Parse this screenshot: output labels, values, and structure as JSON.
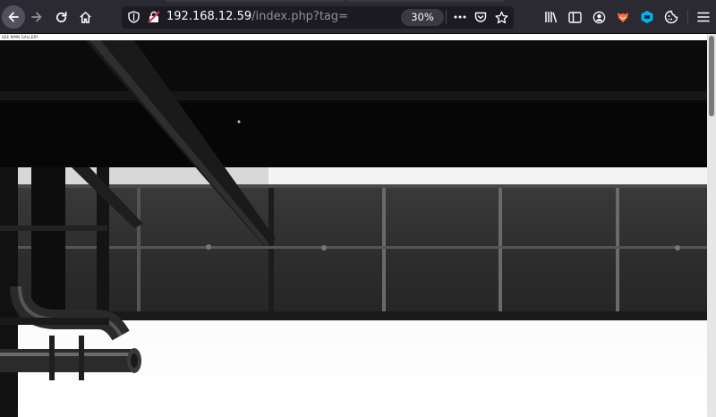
{
  "browser": {
    "url_host": "192.168.12.59",
    "url_path": "/index.php?tag=",
    "zoom_label": "30%",
    "toolbar_icons": [
      "back-icon",
      "forward-icon",
      "reload-icon",
      "home-icon",
      "shield-icon",
      "insecure-lock-icon",
      "page-actions-icon",
      "pocket-icon",
      "bookmark-star-icon",
      "library-icon",
      "sidebar-icon",
      "account-icon",
      "extension-fox-icon",
      "extension-cube-icon",
      "cookie-icon",
      "menu-icon"
    ]
  },
  "page": {
    "label": "SEE MMN GALLERY"
  },
  "colors": {
    "toolbar": "#2b2a33",
    "urlbar": "#1c1b22",
    "accent_red": "#e22850"
  }
}
